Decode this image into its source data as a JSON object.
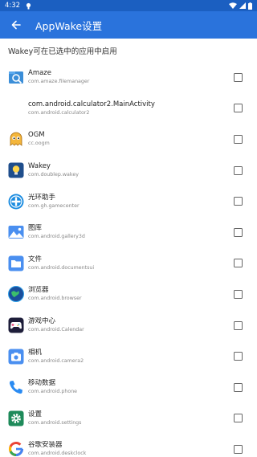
{
  "status_bar": {
    "time": "4:32"
  },
  "app_bar": {
    "title": "AppWake设置"
  },
  "section": {
    "title": "Wakey可在已选中的应用中启用"
  },
  "apps": [
    {
      "name": "Amaze",
      "package": "com.amaze.filemanager",
      "icon": "amaze-icon",
      "checked": false
    },
    {
      "name": "com.android.calculator2.MainActivity",
      "package": "com.android.calculator2",
      "icon": "blank-icon",
      "checked": false
    },
    {
      "name": "OGM",
      "package": "cc.oogm",
      "icon": "ogm-ghost-icon",
      "checked": false
    },
    {
      "name": "Wakey",
      "package": "com.doublep.wakey",
      "icon": "wakey-bulb-icon",
      "checked": false
    },
    {
      "name": "光环助手",
      "package": "com.gh.gamecenter",
      "icon": "gamecenter-icon",
      "checked": false
    },
    {
      "name": "图库",
      "package": "com.android.gallery3d",
      "icon": "gallery-icon",
      "checked": false
    },
    {
      "name": "文件",
      "package": "com.android.documentsui",
      "icon": "files-icon",
      "checked": false
    },
    {
      "name": "浏览器",
      "package": "com.android.browser",
      "icon": "browser-icon",
      "checked": false
    },
    {
      "name": "游戏中心",
      "package": "com.android.Calendar",
      "icon": "gamepad-icon",
      "checked": false
    },
    {
      "name": "相机",
      "package": "com.android.camera2",
      "icon": "camera-icon",
      "checked": false
    },
    {
      "name": "移动数据",
      "package": "com.android.phone",
      "icon": "phone-icon",
      "checked": false
    },
    {
      "name": "设置",
      "package": "com.android.settings",
      "icon": "settings-icon",
      "checked": false
    },
    {
      "name": "谷歌安装器",
      "package": "com.android.deskclock",
      "icon": "google-icon",
      "checked": false
    }
  ],
  "colors": {
    "status_bar": "#1b5fc1",
    "app_bar": "#2a73dc"
  }
}
